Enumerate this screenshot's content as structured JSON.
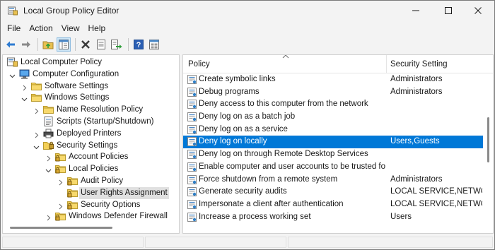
{
  "window": {
    "title": "Local Group Policy Editor"
  },
  "menu": [
    "File",
    "Action",
    "View",
    "Help"
  ],
  "toolbar": [
    "back-icon",
    "forward-icon",
    "up-folder-icon",
    "show-hide-tree-icon",
    "delete-icon",
    "properties-icon",
    "export-list-icon",
    "help-icon",
    "view-icon"
  ],
  "tree": [
    {
      "label": "Local Computer Policy",
      "icon": "computer-policy-icon",
      "chevron": "none",
      "level": 0
    },
    {
      "label": "Computer Configuration",
      "icon": "computer-icon",
      "chevron": "down",
      "level": 1
    },
    {
      "label": "Software Settings",
      "icon": "folder-icon",
      "chevron": "right",
      "level": 2
    },
    {
      "label": "Windows Settings",
      "icon": "folder-icon",
      "chevron": "down",
      "level": 2
    },
    {
      "label": "Name Resolution Policy",
      "icon": "folder-icon",
      "chevron": "right",
      "level": 3
    },
    {
      "label": "Scripts (Startup/Shutdown)",
      "icon": "scripts-icon",
      "chevron": "none",
      "level": 3
    },
    {
      "label": "Deployed Printers",
      "icon": "printer-icon",
      "chevron": "right",
      "level": 3
    },
    {
      "label": "Security Settings",
      "icon": "security-icon",
      "chevron": "down",
      "level": 3
    },
    {
      "label": "Account Policies",
      "icon": "lock-folder-icon",
      "chevron": "right",
      "level": 4
    },
    {
      "label": "Local Policies",
      "icon": "lock-folder-icon",
      "chevron": "down",
      "level": 4
    },
    {
      "label": "Audit Policy",
      "icon": "lock-folder-icon",
      "chevron": "right",
      "level": 5
    },
    {
      "label": "User Rights Assignment",
      "icon": "lock-folder-icon",
      "chevron": "none",
      "level": 5,
      "selected": true
    },
    {
      "label": "Security Options",
      "icon": "lock-folder-icon",
      "chevron": "right",
      "level": 5
    },
    {
      "label": "Windows Defender Firewall w",
      "icon": "lock-folder-icon",
      "chevron": "right",
      "level": 4
    }
  ],
  "list": {
    "columns": {
      "policy": "Policy",
      "setting": "Security Setting"
    },
    "rows": [
      {
        "policy": "Create symbolic links",
        "setting": "Administrators"
      },
      {
        "policy": "Debug programs",
        "setting": "Administrators"
      },
      {
        "policy": "Deny access to this computer from the network",
        "setting": ""
      },
      {
        "policy": "Deny log on as a batch job",
        "setting": ""
      },
      {
        "policy": "Deny log on as a service",
        "setting": ""
      },
      {
        "policy": "Deny log on locally",
        "setting": "Users,Guests",
        "selected": true
      },
      {
        "policy": "Deny log on through Remote Desktop Services",
        "setting": ""
      },
      {
        "policy": "Enable computer and user accounts to be trusted fo...",
        "setting": ""
      },
      {
        "policy": "Force shutdown from a remote system",
        "setting": "Administrators"
      },
      {
        "policy": "Generate security audits",
        "setting": "LOCAL SERVICE,NETWO..."
      },
      {
        "policy": "Impersonate a client after authentication",
        "setting": "LOCAL SERVICE,NETWO..."
      },
      {
        "policy": "Increase a process working set",
        "setting": "Users"
      }
    ]
  },
  "colors": {
    "selection": "#0078d7",
    "tree_selection": "#e0e0e0"
  }
}
